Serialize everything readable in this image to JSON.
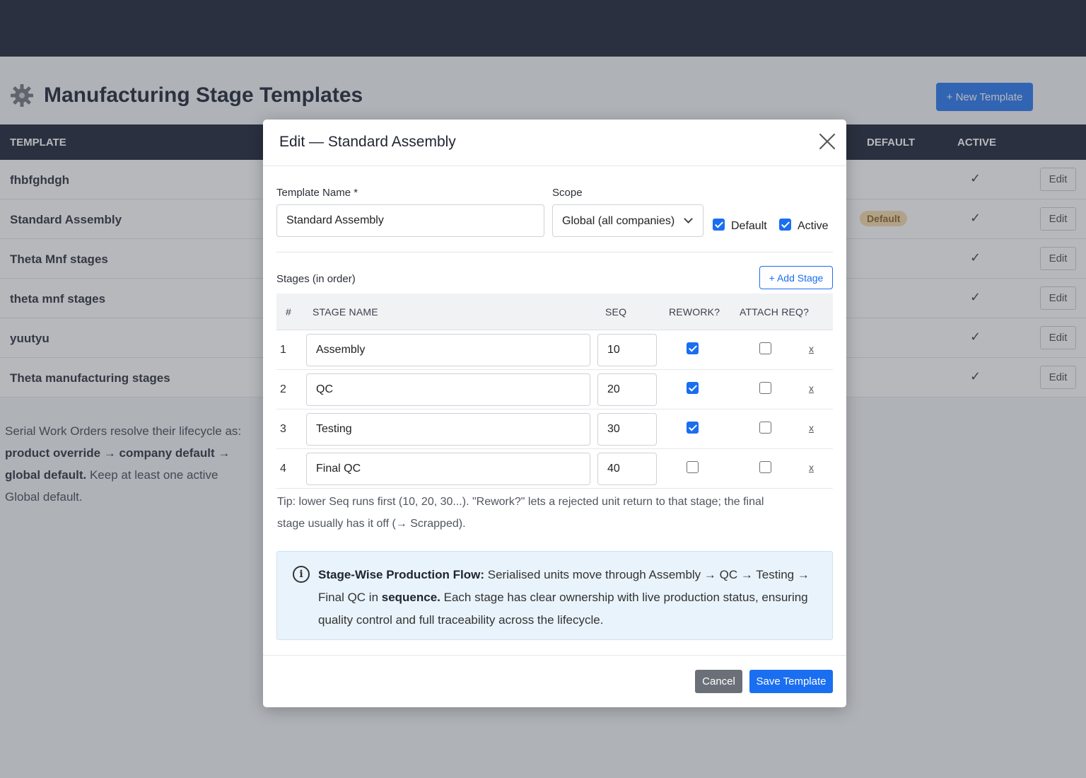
{
  "page": {
    "title": "Manufacturing Stage Templates",
    "new_button": "+ New Template"
  },
  "table": {
    "columns": [
      "TEMPLATE",
      "DEFAULT",
      "ACTIVE"
    ],
    "rows": [
      {
        "name": "fhbfghdgh",
        "default_badge": "",
        "active": "✓",
        "edit": "Edit"
      },
      {
        "name": "Standard Assembly",
        "default_badge": "Default",
        "active": "✓",
        "edit": "Edit"
      },
      {
        "name": "Theta Mnf stages",
        "default_badge": "",
        "active": "✓",
        "edit": "Edit"
      },
      {
        "name": "theta mnf stages",
        "default_badge": "",
        "active": "✓",
        "edit": "Edit"
      },
      {
        "name": "yuutyu",
        "default_badge": "",
        "active": "✓",
        "edit": "Edit"
      },
      {
        "name": "Theta manufacturing stages",
        "default_badge": "",
        "active": "✓",
        "edit": "Edit"
      }
    ]
  },
  "note": {
    "line1": "Serial Work Orders resolve their lifecycle as:",
    "bold": "product override → company default → global default.",
    "rest": " Keep at least one active Global default."
  },
  "modal": {
    "title": "Edit — Standard Assembly",
    "template_name_label": "Template Name *",
    "template_name_value": "Standard Assembly",
    "scope_label": "Scope",
    "scope_value": "Global (all companies)",
    "default_label": "Default",
    "default_checked": true,
    "active_label": "Active",
    "active_checked": true,
    "stages_label": "Stages (in order)",
    "add_stage": "+ Add Stage",
    "stage_columns": {
      "num": "#",
      "name": "STAGE NAME",
      "seq": "SEQ",
      "rework": "REWORK?",
      "attach": "ATTACH REQ?"
    },
    "stages": [
      {
        "num": "1",
        "name": "Assembly",
        "seq": "10",
        "rework": true,
        "attach": false,
        "delete": "x"
      },
      {
        "num": "2",
        "name": "QC",
        "seq": "20",
        "rework": true,
        "attach": false,
        "delete": "x"
      },
      {
        "num": "3",
        "name": "Testing",
        "seq": "30",
        "rework": true,
        "attach": false,
        "delete": "x"
      },
      {
        "num": "4",
        "name": "Final QC",
        "seq": "40",
        "rework": false,
        "attach": false,
        "delete": "x"
      }
    ],
    "tip": "Tip: lower Seq runs first (10, 20, 30...). \"Rework?\" lets a rejected unit return to that stage; the final stage usually has it off (→ Scrapped).",
    "info": {
      "icon": "i",
      "bold_lead": "Stage-Wise Production Flow:",
      "part1": " Serialised units move through Assembly → QC → Testing → Final QC in ",
      "bold_mid": "sequence.",
      "part2": " Each stage has clear ownership with live production status, ensuring quality control and full traceability across the lifecycle."
    },
    "cancel": "Cancel",
    "save": "Save Template"
  },
  "colors": {
    "primary": "#1a6ef0",
    "nav_dark": "#0f1628",
    "badge_bg": "#f4d9a8",
    "cancel_gray": "#6b7078",
    "info_bg": "#e9f3fb"
  },
  "icons": {
    "page": "gear-icon",
    "close": "close-icon",
    "scope": "chevron-down-icon",
    "info": "info-icon"
  }
}
